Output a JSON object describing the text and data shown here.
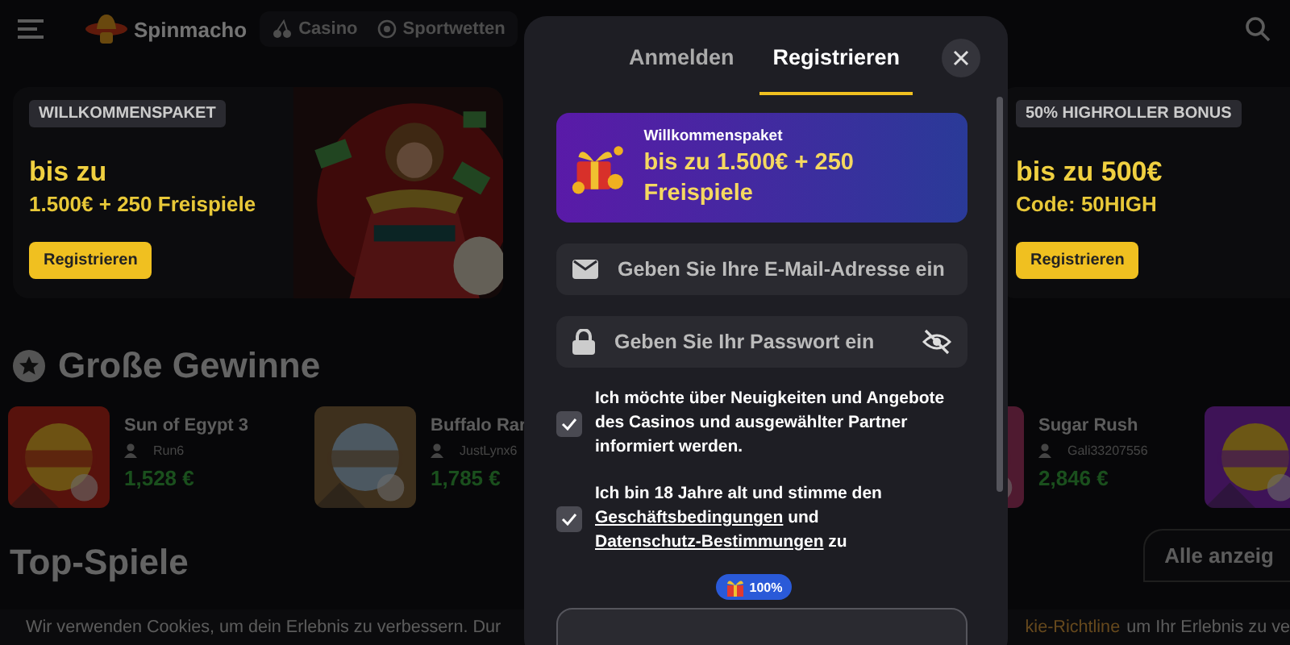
{
  "header": {
    "logo_text": "Spinmacho",
    "nav": [
      {
        "kind": "casino",
        "label": "Casino"
      },
      {
        "kind": "sports",
        "label": "Sportwetten"
      }
    ]
  },
  "promos": [
    {
      "badge": "WILLKOMMENSPAKET",
      "title": "bis zu",
      "subtitle": "1.500€ + 250 Freispiele",
      "button": "Registrieren"
    },
    {
      "badge": "50% HIGHROLLER BONUS",
      "title": "bis zu 500€",
      "subtitle": "Code: 50HIGH",
      "button": "Registrieren"
    }
  ],
  "big_wins": {
    "heading": "Große Gewinne",
    "items": [
      {
        "kind": "full",
        "game": "Sun of Egypt 3",
        "player": "Run6",
        "amount": "1,528 €"
      },
      {
        "kind": "full",
        "game": "Buffalo Rar",
        "player": "JustLynx6",
        "amount": "1,785 €"
      },
      {
        "kind": "full",
        "game": "Sugar Rush",
        "player": "Gali33207556",
        "amount": "2,846 €"
      },
      {
        "kind": "thumb"
      }
    ]
  },
  "top_games": {
    "heading": "Top-Spiele",
    "button": "Alle anzeig"
  },
  "cookie_bar": {
    "text_left": "Wir verwenden Cookies, um dein Erlebnis zu verbessern. Dur",
    "link": "kie-Richtline",
    "text_right": "um Ihr Erlebnis zu ve"
  },
  "modal": {
    "tabs": [
      {
        "label": "Anmelden",
        "selected": false
      },
      {
        "label": "Registrieren",
        "selected": true
      }
    ],
    "banner": {
      "label": "Willkommenspaket",
      "title": "bis zu 1.500€ + 250 Freispiele"
    },
    "fields": [
      {
        "kind": "email",
        "placeholder": "Geben Sie Ihre E-Mail-Adresse ein"
      },
      {
        "kind": "password",
        "placeholder": "Geben Sie Ihr Passwort ein"
      }
    ],
    "consents": [
      {
        "checked": true,
        "parts": [
          {
            "kind": "text",
            "text": "Ich möchte über Neuigkeiten und Angebote des Casinos und ausgewählter Partner informiert werden."
          }
        ]
      },
      {
        "checked": true,
        "parts": [
          {
            "kind": "text",
            "text": "Ich bin 18 Jahre alt und stimme den "
          },
          {
            "kind": "link",
            "text": "Geschäftsbedingungen"
          },
          {
            "kind": "text",
            "text": " und "
          },
          {
            "kind": "link",
            "text": "Datenschutz-Bestimmungen"
          },
          {
            "kind": "text",
            "text": " zu"
          }
        ]
      }
    ],
    "badge": "100%"
  }
}
